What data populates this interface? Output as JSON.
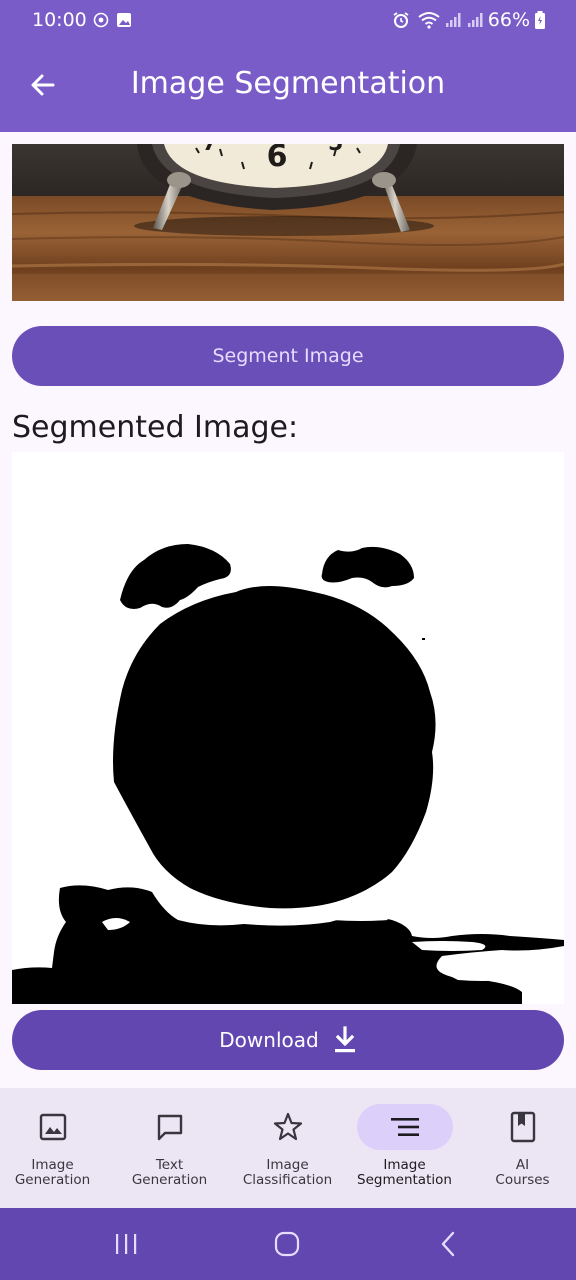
{
  "status_bar": {
    "time": "10:00",
    "battery_percent": "66%",
    "left_icons": [
      "whatsapp-icon",
      "gallery-icon"
    ],
    "right_icons": [
      "alarm-icon",
      "wifi-icon",
      "signal-icon",
      "signal-icon",
      "battery-icon"
    ]
  },
  "app_bar": {
    "title": "Image Segmentation",
    "back_icon": "arrow-left-icon"
  },
  "main": {
    "segment_button_label": "Segment Image",
    "segmented_heading": "Segmented Image:",
    "download_label": "Download",
    "download_icon": "download-icon"
  },
  "bottom_nav": {
    "active_index": 3,
    "items": [
      {
        "label": "Image\nGeneration",
        "icon": "image-icon"
      },
      {
        "label": "Text\nGeneration",
        "icon": "chat-bubble-icon"
      },
      {
        "label": "Image\nClassification",
        "icon": "star-icon"
      },
      {
        "label": "Image\nSegmentation",
        "icon": "segment-lines-icon"
      },
      {
        "label": "AI\nCourses",
        "icon": "book-icon"
      }
    ]
  },
  "system_nav": {
    "buttons": [
      "recents-icon",
      "home-icon",
      "back-icon"
    ]
  },
  "colors": {
    "primary": "#7a5cc8",
    "button": "#6a4fb8",
    "nav_background": "#ece6f4",
    "nav_active_pill": "#dcd0fb",
    "system_nav": "#6247b0"
  }
}
